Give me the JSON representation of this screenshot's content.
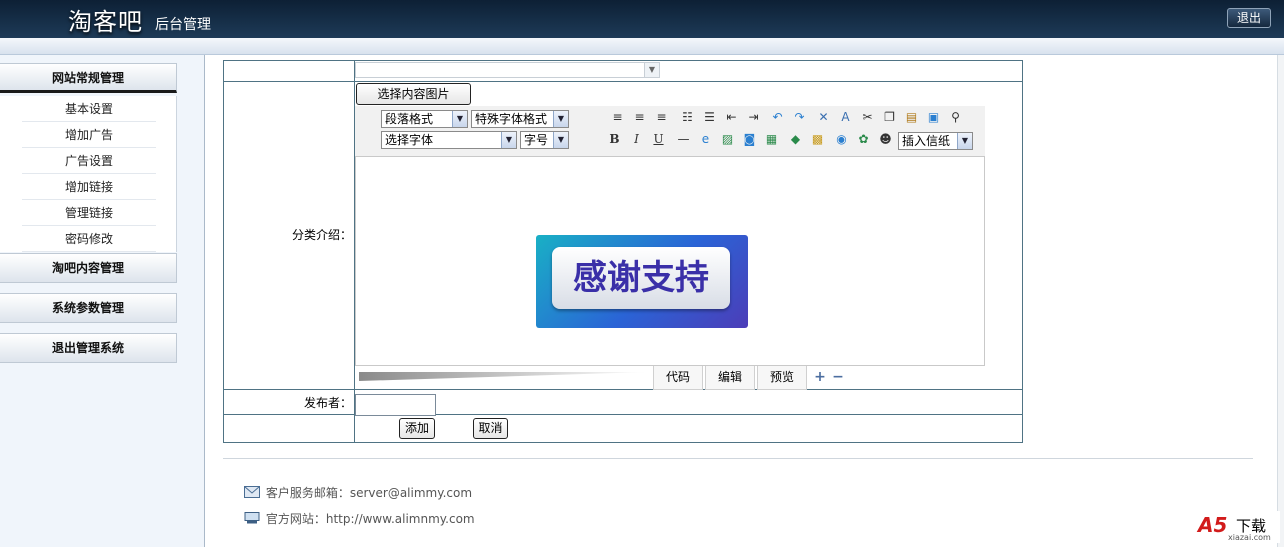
{
  "header": {
    "brand": "淘客吧",
    "brand_sub": "后台管理",
    "logout": "退出"
  },
  "sidebar": {
    "sections": [
      {
        "label": "网站常规管理",
        "active": true
      },
      {
        "label": "淘吧内容管理"
      },
      {
        "label": "系统参数管理"
      },
      {
        "label": "退出管理系统"
      }
    ],
    "items": [
      {
        "label": "基本设置"
      },
      {
        "label": "增加广告"
      },
      {
        "label": "广告设置"
      },
      {
        "label": "增加链接"
      },
      {
        "label": "管理链接"
      },
      {
        "label": "密码修改"
      }
    ]
  },
  "form": {
    "choose_image_button": "选择内容图片",
    "category_intro_label": "分类介绍：",
    "publisher_label": "发布者：",
    "publisher_value": "",
    "add_button": "添加",
    "cancel_button": "取消"
  },
  "editor": {
    "paragraph_format": "段落格式",
    "special_format": "特殊字体格式",
    "font_select": "选择字体",
    "font_size": "字号",
    "insert_paper": "插入信纸",
    "content_image_text": "感谢支持",
    "tabs": [
      {
        "label": "代码"
      },
      {
        "label": "编辑"
      },
      {
        "label": "预览"
      }
    ],
    "toolbar_icons_row1": [
      "align-left-icon",
      "align-center-icon",
      "align-right-icon",
      "unordered-list-icon",
      "ordered-list-icon",
      "outdent-icon",
      "indent-icon",
      "undo-icon",
      "redo-icon",
      "delete-icon",
      "clear-format-icon",
      "cut-icon",
      "copy-icon",
      "paste-icon",
      "paste-text-icon",
      "find-icon"
    ],
    "toolbar_icons_row2": [
      "bold-icon",
      "italic-icon",
      "underline-icon",
      "horizontal-rule-icon",
      "link-icon",
      "image-icon",
      "media-icon",
      "table-icon",
      "flash-icon",
      "color-icon",
      "emoticon-icon",
      "chat-icon",
      "qq-icon"
    ]
  },
  "footer": {
    "email_label": "客户服务邮箱：",
    "email": "server@alimmy.com",
    "site_label": "官方网站：",
    "site_url": "http://www.alimnmy.com"
  },
  "watermark": {
    "brand": "A5",
    "text": "下载",
    "url": "xiazai.com"
  }
}
